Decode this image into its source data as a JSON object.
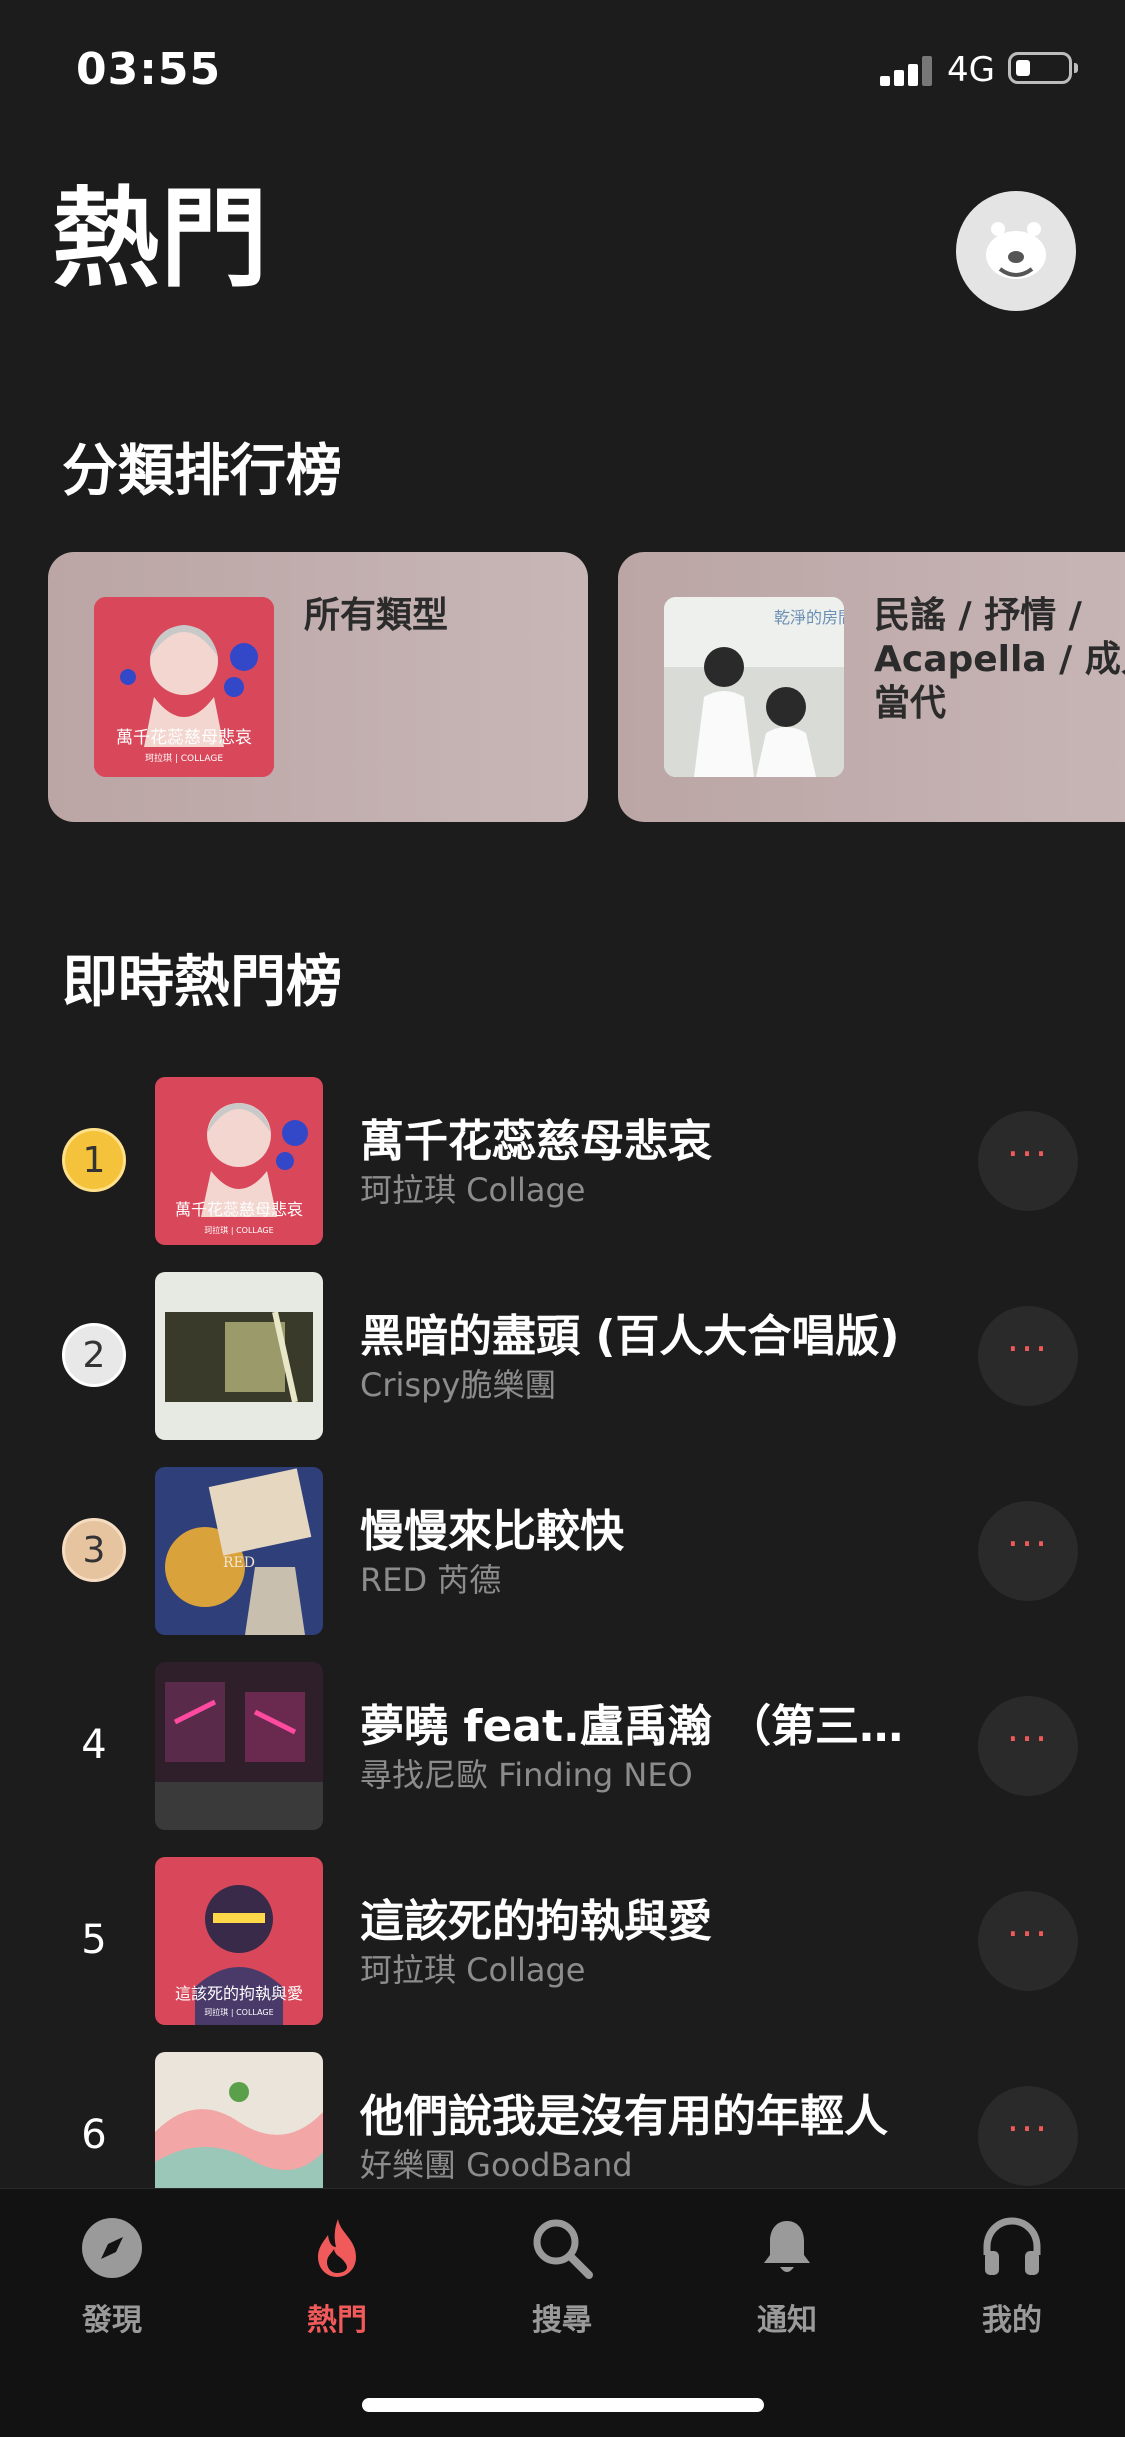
{
  "status": {
    "time": "03:55",
    "network": "4G"
  },
  "header": {
    "title": "熱門"
  },
  "categories": {
    "title": "分類排行榜",
    "items": [
      {
        "label": "所有類型",
        "art": {
          "text": "萬千花蕊慈母悲哀",
          "sub": "珂拉琪 | COLLAGE"
        }
      },
      {
        "label_lines": [
          "民謠 / 抒情 /",
          "Acapella / 成人",
          "當代"
        ],
        "art": {
          "text": "乾淨的房間"
        }
      }
    ]
  },
  "chart": {
    "title": "即時熱門榜",
    "tracks": [
      {
        "rank": "1",
        "title": "萬千花蕊慈母悲哀",
        "artist": "珂拉琪 Collage",
        "art_text": "萬千花蕊慈母悲哀",
        "art_sub": "珂拉琪 | COLLAGE"
      },
      {
        "rank": "2",
        "title": "黑暗的盡頭 (百人大合唱版)",
        "artist": "Crispy脆樂團"
      },
      {
        "rank": "3",
        "title": "慢慢來比較快",
        "artist": "RED 芮德",
        "art_text": "RED"
      },
      {
        "rank": "4",
        "title": "夢曉 feat.盧禹瀚 （第三十…",
        "artist": "尋找尼歐 Finding NEO"
      },
      {
        "rank": "5",
        "title": "這該死的拘執與愛",
        "artist": "珂拉琪 Collage",
        "art_text": "這該死的拘執與愛",
        "art_sub": "珂拉琪 | COLLAGE"
      },
      {
        "rank": "6",
        "title": "他們說我是沒有用的年輕人",
        "artist": "好樂團 GoodBand"
      }
    ],
    "more_label": "···"
  },
  "tabbar": {
    "items": [
      {
        "label": "發現",
        "icon": "compass-icon",
        "active": false
      },
      {
        "label": "熱門",
        "icon": "flame-icon",
        "active": true
      },
      {
        "label": "搜尋",
        "icon": "search-icon",
        "active": false
      },
      {
        "label": "通知",
        "icon": "bell-icon",
        "active": false
      },
      {
        "label": "我的",
        "icon": "headphones-icon",
        "active": false
      }
    ]
  },
  "colors": {
    "accent": "#f05a5a",
    "background": "#1c1c1c",
    "gold": "#f5c33b",
    "silver": "#e8e8e8",
    "bronze": "#e7c4a0"
  }
}
